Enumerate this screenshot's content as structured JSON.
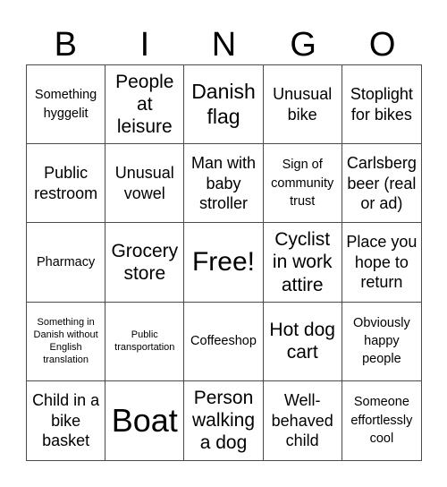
{
  "header": {
    "letters": [
      "B",
      "I",
      "N",
      "G",
      "O"
    ]
  },
  "cells": [
    {
      "text": "Something hyggelit",
      "size": "s-s"
    },
    {
      "text": "People at leisure",
      "size": "s-l"
    },
    {
      "text": "Danish flag",
      "size": "s-l2"
    },
    {
      "text": "Unusual bike",
      "size": "s-m"
    },
    {
      "text": "Stoplight for bikes",
      "size": "s-m"
    },
    {
      "text": "Public restroom",
      "size": "s-m"
    },
    {
      "text": "Unusual vowel",
      "size": "s-m"
    },
    {
      "text": "Man with baby stroller",
      "size": "s-m"
    },
    {
      "text": "Sign of community trust",
      "size": "s-s"
    },
    {
      "text": "Carlsberg beer (real or ad)",
      "size": "s-m"
    },
    {
      "text": "Pharmacy",
      "size": "s-s"
    },
    {
      "text": "Grocery store",
      "size": "s-l"
    },
    {
      "text": "Free!",
      "size": "s-xl"
    },
    {
      "text": "Cyclist in work attire",
      "size": "s-l"
    },
    {
      "text": "Place you hope to return",
      "size": "s-m"
    },
    {
      "text": "Something in Danish without English translation",
      "size": "s-xs"
    },
    {
      "text": "Public transportation",
      "size": "s-xs"
    },
    {
      "text": "Coffeeshop",
      "size": "s-s"
    },
    {
      "text": "Hot dog cart",
      "size": "s-l"
    },
    {
      "text": "Obviously happy people",
      "size": "s-s"
    },
    {
      "text": "Child in a bike basket",
      "size": "s-m"
    },
    {
      "text": "Boat",
      "size": "s-xxl"
    },
    {
      "text": "Person walking a dog",
      "size": "s-l"
    },
    {
      "text": "Well-behaved child",
      "size": "s-m"
    },
    {
      "text": "Someone effortlessly cool",
      "size": "s-s"
    }
  ]
}
